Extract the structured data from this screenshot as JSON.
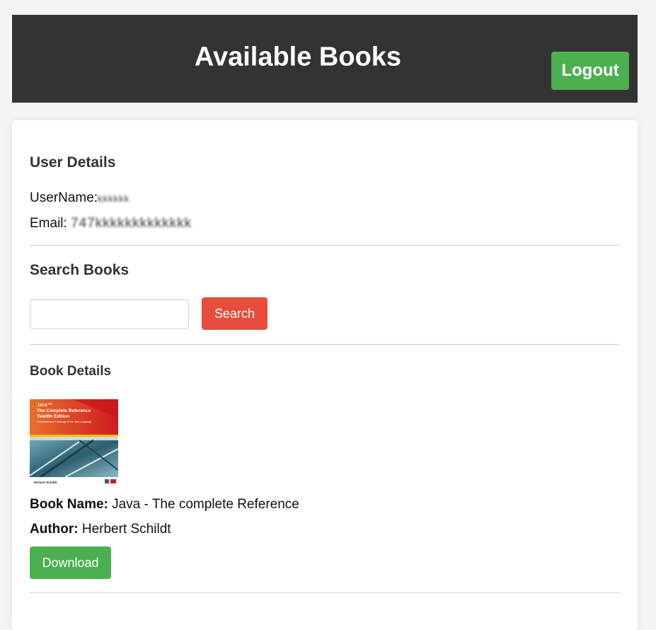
{
  "header": {
    "title": "Available Books",
    "logout_label": "Logout"
  },
  "user_details": {
    "heading": "User Details",
    "username_label": "UserName:",
    "username_value": "kkkkkk",
    "email_label": "Email:",
    "email_value": "747kkkkkkkkkkkkk"
  },
  "search": {
    "heading": "Search Books",
    "input_value": "",
    "placeholder": "",
    "button_label": "Search"
  },
  "book": {
    "heading": "Book Details",
    "cover": {
      "brand": "Java™",
      "title_line1": "The Complete Reference",
      "title_line2": "Twelfth Edition",
      "subtitle": "Comprehensive Coverage of the Java Language",
      "author": "Herbert Schildt"
    },
    "name_label": "Book Name:",
    "name_value": "Java - The complete Reference",
    "author_label": "Author:",
    "author_value": "Herbert Schildt",
    "download_label": "Download"
  },
  "colors": {
    "header_bg": "#333333",
    "logout_bg": "#4caf50",
    "search_bg": "#e74c3c",
    "download_bg": "#4caf50"
  },
  "icons": []
}
